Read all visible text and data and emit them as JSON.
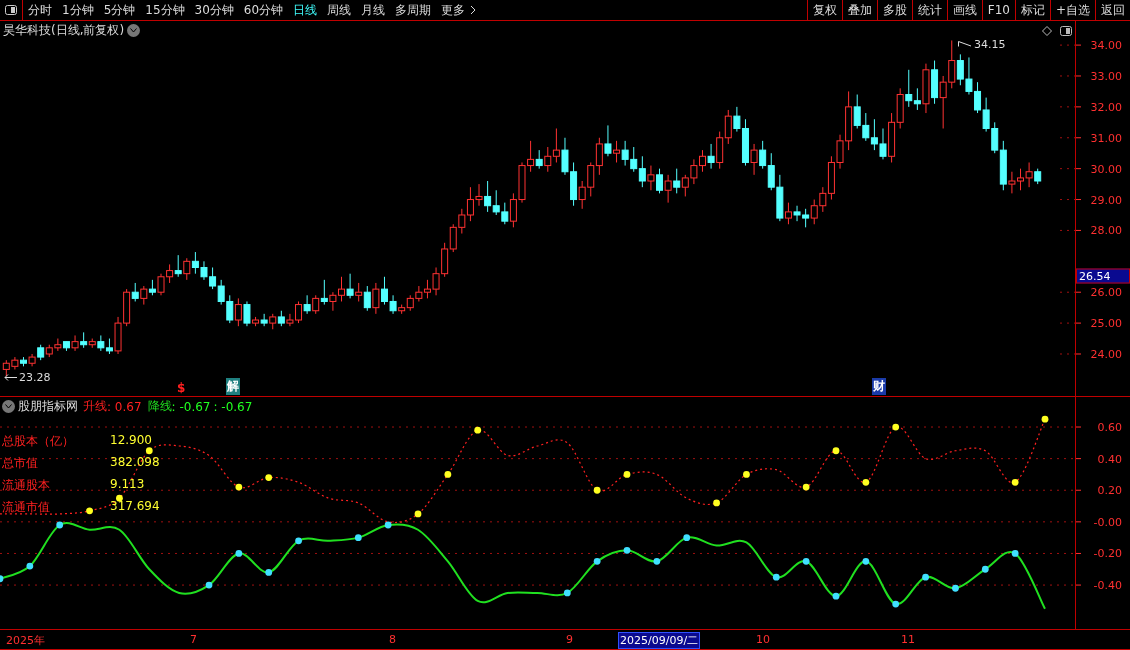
{
  "toolbar": {
    "periods": [
      {
        "label": "分时",
        "selected": false
      },
      {
        "label": "1分钟",
        "selected": false
      },
      {
        "label": "5分钟",
        "selected": false
      },
      {
        "label": "15分钟",
        "selected": false
      },
      {
        "label": "30分钟",
        "selected": false
      },
      {
        "label": "60分钟",
        "selected": false
      },
      {
        "label": "日线",
        "selected": true
      },
      {
        "label": "周线",
        "selected": false
      },
      {
        "label": "月线",
        "selected": false
      },
      {
        "label": "多周期",
        "selected": false
      }
    ],
    "more": "更多",
    "actions": [
      "复权",
      "叠加",
      "多股",
      "统计",
      "画线",
      "F10",
      "标记",
      "+自选",
      "返回"
    ]
  },
  "price_chart": {
    "title": "昊华科技(日线,前复权)",
    "high_label": "34.15",
    "low_label": "23.28",
    "current_price": "26.54",
    "events": [
      {
        "label": "$",
        "color": "#ff2020"
      },
      {
        "label": "解",
        "color": "#1f8080"
      },
      {
        "label": "财",
        "color": "#1a3aa8"
      }
    ],
    "chart_data": {
      "type": "candlestick",
      "ylim": [
        22.64,
        34.78
      ],
      "yticks": [
        {
          "value": 34,
          "label": "34.00"
        },
        {
          "value": 33,
          "label": "33.00"
        },
        {
          "value": 32,
          "label": "32.00"
        },
        {
          "value": 31,
          "label": "31.00"
        },
        {
          "value": 30,
          "label": "30.00"
        },
        {
          "value": 29,
          "label": "29.00"
        },
        {
          "value": 28,
          "label": "28.00"
        },
        {
          "value": 26,
          "label": "26.00"
        },
        {
          "value": 25,
          "label": "25.00"
        },
        {
          "value": 24,
          "label": "24.00"
        }
      ],
      "ohlc": [
        [
          23.5,
          23.8,
          23.28,
          23.7
        ],
        [
          23.6,
          23.9,
          23.5,
          23.8
        ],
        [
          23.8,
          23.9,
          23.6,
          23.7
        ],
        [
          23.7,
          24.0,
          23.6,
          23.9
        ],
        [
          24.2,
          24.3,
          23.8,
          23.9
        ],
        [
          24.0,
          24.3,
          23.9,
          24.2
        ],
        [
          24.2,
          24.5,
          24.1,
          24.3
        ],
        [
          24.4,
          24.4,
          24.1,
          24.2
        ],
        [
          24.2,
          24.6,
          24.1,
          24.4
        ],
        [
          24.4,
          24.7,
          24.2,
          24.3
        ],
        [
          24.3,
          24.5,
          24.2,
          24.4
        ],
        [
          24.4,
          24.6,
          24.1,
          24.2
        ],
        [
          24.2,
          24.5,
          24.0,
          24.1
        ],
        [
          24.1,
          25.2,
          24.0,
          25.0
        ],
        [
          25.0,
          26.1,
          24.9,
          26.0
        ],
        [
          26.0,
          26.3,
          25.7,
          25.8
        ],
        [
          25.8,
          26.2,
          25.6,
          26.1
        ],
        [
          26.1,
          26.4,
          25.9,
          26.0
        ],
        [
          26.0,
          26.6,
          25.9,
          26.5
        ],
        [
          26.5,
          26.9,
          26.3,
          26.7
        ],
        [
          26.7,
          27.2,
          26.5,
          26.6
        ],
        [
          26.6,
          27.1,
          26.4,
          27.0
        ],
        [
          27.0,
          27.3,
          26.6,
          26.8
        ],
        [
          26.8,
          27.0,
          26.4,
          26.5
        ],
        [
          26.5,
          26.8,
          26.1,
          26.2
        ],
        [
          26.2,
          26.4,
          25.6,
          25.7
        ],
        [
          25.7,
          25.9,
          25.0,
          25.1
        ],
        [
          25.1,
          25.8,
          24.9,
          25.6
        ],
        [
          25.6,
          25.7,
          24.9,
          25.0
        ],
        [
          25.0,
          25.2,
          24.9,
          25.1
        ],
        [
          25.1,
          25.3,
          24.9,
          25.0
        ],
        [
          25.0,
          25.3,
          24.8,
          25.2
        ],
        [
          25.2,
          25.4,
          24.9,
          25.0
        ],
        [
          25.0,
          25.3,
          24.9,
          25.1
        ],
        [
          25.1,
          25.7,
          25.0,
          25.6
        ],
        [
          25.6,
          25.9,
          25.3,
          25.4
        ],
        [
          25.4,
          25.9,
          25.3,
          25.8
        ],
        [
          25.8,
          26.4,
          25.6,
          25.7
        ],
        [
          25.7,
          26.0,
          25.4,
          25.9
        ],
        [
          25.9,
          26.5,
          25.7,
          26.1
        ],
        [
          26.1,
          26.6,
          25.8,
          25.9
        ],
        [
          25.9,
          26.3,
          25.7,
          26.0
        ],
        [
          26.0,
          26.2,
          25.4,
          25.5
        ],
        [
          25.5,
          26.3,
          25.3,
          26.1
        ],
        [
          26.1,
          26.5,
          25.6,
          25.7
        ],
        [
          25.7,
          25.9,
          25.3,
          25.4
        ],
        [
          25.4,
          25.6,
          25.3,
          25.5
        ],
        [
          25.5,
          25.9,
          25.4,
          25.8
        ],
        [
          25.8,
          26.2,
          25.7,
          26.0
        ],
        [
          26.0,
          26.4,
          25.8,
          26.1
        ],
        [
          26.1,
          26.8,
          25.9,
          26.6
        ],
        [
          26.6,
          27.6,
          26.5,
          27.4
        ],
        [
          27.4,
          28.2,
          27.3,
          28.1
        ],
        [
          28.1,
          28.7,
          27.9,
          28.5
        ],
        [
          28.5,
          29.4,
          28.3,
          29.0
        ],
        [
          29.0,
          29.5,
          28.8,
          29.1
        ],
        [
          29.1,
          29.6,
          28.6,
          28.8
        ],
        [
          28.8,
          29.3,
          28.5,
          28.6
        ],
        [
          28.6,
          28.9,
          28.2,
          28.3
        ],
        [
          28.3,
          29.2,
          28.1,
          29.0
        ],
        [
          29.0,
          30.2,
          28.9,
          30.1
        ],
        [
          30.1,
          30.9,
          29.9,
          30.3
        ],
        [
          30.3,
          30.6,
          30.0,
          30.1
        ],
        [
          30.1,
          30.7,
          29.9,
          30.4
        ],
        [
          30.4,
          31.3,
          30.2,
          30.6
        ],
        [
          30.6,
          31.0,
          29.8,
          29.9
        ],
        [
          29.9,
          30.2,
          28.8,
          29.0
        ],
        [
          29.0,
          29.6,
          28.7,
          29.4
        ],
        [
          29.4,
          30.2,
          29.1,
          30.1
        ],
        [
          30.1,
          31.0,
          29.8,
          30.8
        ],
        [
          30.8,
          31.4,
          30.4,
          30.5
        ],
        [
          30.5,
          30.9,
          30.2,
          30.6
        ],
        [
          30.6,
          30.9,
          30.1,
          30.3
        ],
        [
          30.3,
          30.7,
          29.9,
          30.0
        ],
        [
          30.0,
          30.4,
          29.4,
          29.6
        ],
        [
          29.6,
          30.1,
          29.3,
          29.8
        ],
        [
          29.8,
          30.0,
          29.2,
          29.3
        ],
        [
          29.3,
          29.8,
          28.9,
          29.6
        ],
        [
          29.6,
          30.0,
          29.2,
          29.4
        ],
        [
          29.4,
          29.8,
          29.1,
          29.7
        ],
        [
          29.7,
          30.3,
          29.5,
          30.1
        ],
        [
          30.1,
          30.6,
          29.9,
          30.4
        ],
        [
          30.4,
          30.8,
          30.0,
          30.2
        ],
        [
          30.2,
          31.2,
          30.0,
          31.0
        ],
        [
          31.0,
          31.9,
          30.8,
          31.7
        ],
        [
          31.7,
          32.0,
          31.2,
          31.3
        ],
        [
          31.3,
          31.6,
          30.1,
          30.2
        ],
        [
          30.2,
          30.8,
          29.8,
          30.6
        ],
        [
          30.6,
          30.9,
          30.0,
          30.1
        ],
        [
          30.1,
          30.5,
          29.3,
          29.4
        ],
        [
          29.4,
          29.8,
          28.3,
          28.4
        ],
        [
          28.4,
          28.9,
          28.2,
          28.6
        ],
        [
          28.6,
          28.8,
          28.3,
          28.5
        ],
        [
          28.5,
          28.7,
          28.1,
          28.4
        ],
        [
          28.4,
          29.0,
          28.2,
          28.8
        ],
        [
          28.8,
          29.4,
          28.6,
          29.2
        ],
        [
          29.2,
          30.4,
          29.0,
          30.2
        ],
        [
          30.2,
          31.1,
          30.0,
          30.9
        ],
        [
          30.9,
          32.5,
          30.6,
          32.0
        ],
        [
          32.0,
          32.4,
          31.3,
          31.4
        ],
        [
          31.4,
          31.8,
          30.9,
          31.0
        ],
        [
          31.0,
          31.6,
          30.6,
          30.8
        ],
        [
          30.8,
          31.3,
          30.3,
          30.4
        ],
        [
          30.4,
          31.8,
          30.2,
          31.5
        ],
        [
          31.5,
          32.6,
          31.3,
          32.4
        ],
        [
          32.4,
          33.2,
          32.0,
          32.2
        ],
        [
          32.2,
          32.6,
          31.9,
          32.1
        ],
        [
          32.1,
          33.4,
          31.8,
          33.2
        ],
        [
          33.2,
          33.5,
          32.1,
          32.3
        ],
        [
          32.3,
          33.0,
          31.3,
          32.8
        ],
        [
          32.8,
          34.15,
          32.6,
          33.5
        ],
        [
          33.5,
          33.7,
          32.7,
          32.9
        ],
        [
          32.9,
          33.6,
          32.4,
          32.5
        ],
        [
          32.5,
          32.8,
          31.8,
          31.9
        ],
        [
          31.9,
          32.3,
          31.2,
          31.3
        ],
        [
          31.3,
          31.5,
          30.5,
          30.6
        ],
        [
          30.6,
          30.9,
          29.3,
          29.5
        ],
        [
          29.5,
          29.9,
          29.2,
          29.6
        ],
        [
          29.6,
          30.0,
          29.3,
          29.7
        ],
        [
          29.7,
          30.2,
          29.4,
          29.9
        ],
        [
          29.9,
          30.0,
          29.5,
          29.6
        ]
      ]
    }
  },
  "indicator": {
    "name": "股朋指标网",
    "readings": [
      {
        "value": ": 0.67",
        "color": "#ff2020"
      },
      {
        "value": ": -0.67",
        "color": "#20ff20"
      },
      {
        "value": ": -0.67",
        "color": "#20ff20"
      }
    ],
    "stats": [
      {
        "label": "总股本（亿）",
        "value": "12.900"
      },
      {
        "label": "总市值",
        "value": "382.098"
      },
      {
        "label": "流通股本",
        "value": "9.113"
      },
      {
        "label": "流通市值",
        "value": "317.694"
      }
    ],
    "chart_data": {
      "type": "line",
      "ylim": [
        -0.678,
        0.79
      ],
      "grid": true,
      "yticks": [
        {
          "value": 0.6,
          "label": "0.60"
        },
        {
          "value": 0.4,
          "label": "0.40"
        },
        {
          "value": 0.2,
          "label": "0.20"
        },
        {
          "value": 0,
          "label": "-0.00"
        },
        {
          "value": -0.2,
          "label": "-0.20"
        },
        {
          "value": -0.4,
          "label": "-0.40"
        }
      ],
      "series": [
        {
          "name": "升线",
          "color": "#ff2020",
          "line_style": "dashed",
          "values": [
            0.05,
            0.05,
            0.05,
            0.07,
            0.15,
            0.45,
            0.48,
            0.42,
            0.22,
            0.28,
            0.25,
            0.15,
            0.12,
            0.0,
            0.05,
            0.3,
            0.58,
            0.42,
            0.48,
            0.5,
            0.2,
            0.3,
            0.3,
            0.15,
            0.12,
            0.3,
            0.33,
            0.22,
            0.45,
            0.25,
            0.6,
            0.4,
            0.45,
            0.45,
            0.25,
            0.65
          ]
        },
        {
          "name": "降线",
          "color": "#20e020",
          "line_style": "solid",
          "values": [
            -0.36,
            -0.28,
            -0.02,
            -0.05,
            -0.05,
            -0.3,
            -0.45,
            -0.4,
            -0.2,
            -0.32,
            -0.12,
            -0.12,
            -0.1,
            -0.02,
            -0.05,
            -0.25,
            -0.5,
            -0.45,
            -0.45,
            -0.45,
            -0.25,
            -0.18,
            -0.25,
            -0.1,
            -0.15,
            -0.13,
            -0.35,
            -0.25,
            -0.47,
            -0.25,
            -0.52,
            -0.35,
            -0.42,
            -0.3,
            -0.2,
            -0.55
          ]
        }
      ]
    }
  },
  "time_axis": [
    {
      "label": "2025年",
      "selected": false
    },
    {
      "label": "7",
      "selected": false
    },
    {
      "label": "8",
      "selected": false
    },
    {
      "label": "9",
      "selected": false
    },
    {
      "label": "2025/09/09/二",
      "selected": true
    },
    {
      "label": "10",
      "selected": false
    },
    {
      "label": "11",
      "selected": false
    }
  ]
}
